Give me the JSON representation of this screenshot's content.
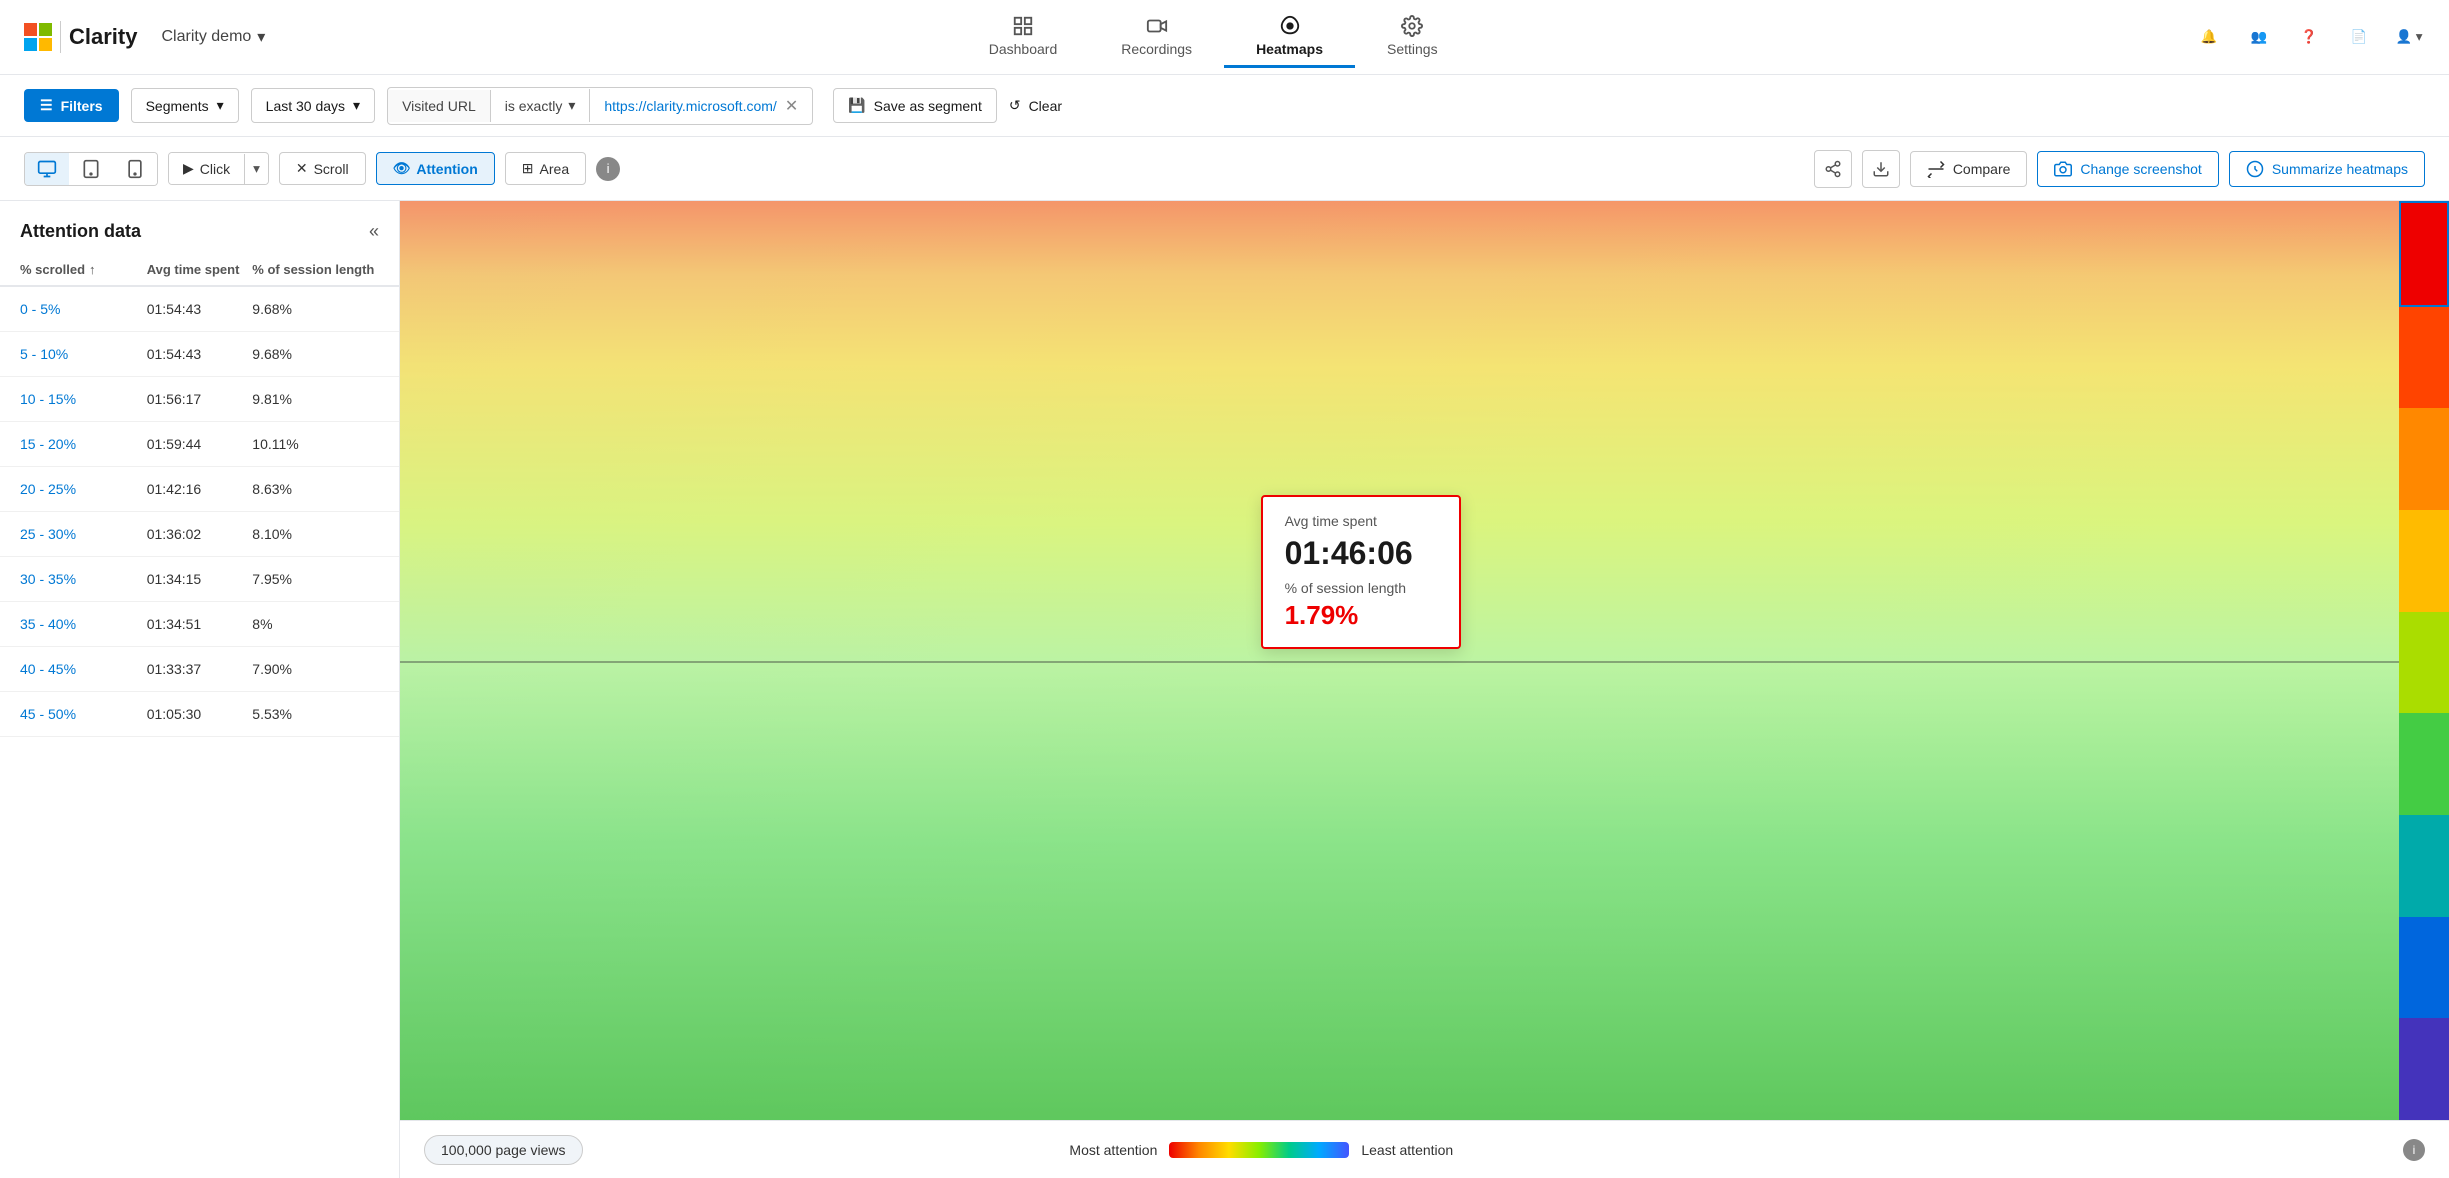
{
  "app": {
    "ms_label": "Microsoft",
    "clarity_label": "Clarity",
    "project_name": "Clarity demo",
    "chevron": "▾"
  },
  "nav": {
    "items": [
      {
        "id": "dashboard",
        "label": "Dashboard",
        "icon": "dashboard-icon"
      },
      {
        "id": "recordings",
        "label": "Recordings",
        "icon": "recordings-icon"
      },
      {
        "id": "heatmaps",
        "label": "Heatmaps",
        "icon": "heatmaps-icon",
        "active": true
      },
      {
        "id": "settings",
        "label": "Settings",
        "icon": "settings-icon"
      }
    ]
  },
  "filters": {
    "filters_btn": "Filters",
    "segments_btn": "Segments",
    "days_btn": "Last 30 days",
    "visited_url_label": "Visited URL",
    "url_filter_type": "is exactly",
    "url_value": "https://clarity.microsoft.com/",
    "save_segment_label": "Save as segment",
    "clear_label": "Clear"
  },
  "toolbar": {
    "view_modes": [
      "desktop",
      "tablet",
      "mobile"
    ],
    "heatmap_types": [
      {
        "id": "click",
        "label": "Click",
        "active": false
      },
      {
        "id": "scroll",
        "label": "Scroll",
        "active": false
      },
      {
        "id": "attention",
        "label": "Attention",
        "active": true
      },
      {
        "id": "area",
        "label": "Area",
        "active": false
      }
    ],
    "compare_btn": "Compare",
    "change_screenshot_btn": "Change screenshot",
    "summarize_btn": "Summarize heatmaps"
  },
  "left_panel": {
    "title": "Attention data",
    "columns": {
      "scroll": "% scrolled",
      "time": "Avg time spent",
      "session": "% of session length"
    },
    "rows": [
      {
        "scroll": "0 - 5%",
        "time": "01:54:43",
        "session": "9.68%"
      },
      {
        "scroll": "5 - 10%",
        "time": "01:54:43",
        "session": "9.68%"
      },
      {
        "scroll": "10 - 15%",
        "time": "01:56:17",
        "session": "9.81%"
      },
      {
        "scroll": "15 - 20%",
        "time": "01:59:44",
        "session": "10.11%"
      },
      {
        "scroll": "20 - 25%",
        "time": "01:42:16",
        "session": "8.63%"
      },
      {
        "scroll": "25 - 30%",
        "time": "01:36:02",
        "session": "8.10%"
      },
      {
        "scroll": "30 - 35%",
        "time": "01:34:15",
        "session": "7.95%"
      },
      {
        "scroll": "35 - 40%",
        "time": "01:34:51",
        "session": "8%"
      },
      {
        "scroll": "40 - 45%",
        "time": "01:33:37",
        "session": "7.90%"
      },
      {
        "scroll": "45 - 50%",
        "time": "01:05:30",
        "session": "5.53%"
      }
    ]
  },
  "heatmap_tooltip": {
    "avg_time_label": "Avg time spent",
    "avg_time_value": "01:46:06",
    "session_label": "% of session length",
    "session_value": "1.79%"
  },
  "bottom": {
    "page_views": "100,000 page views",
    "most_attention": "Most attention",
    "least_attention": "Least attention"
  }
}
